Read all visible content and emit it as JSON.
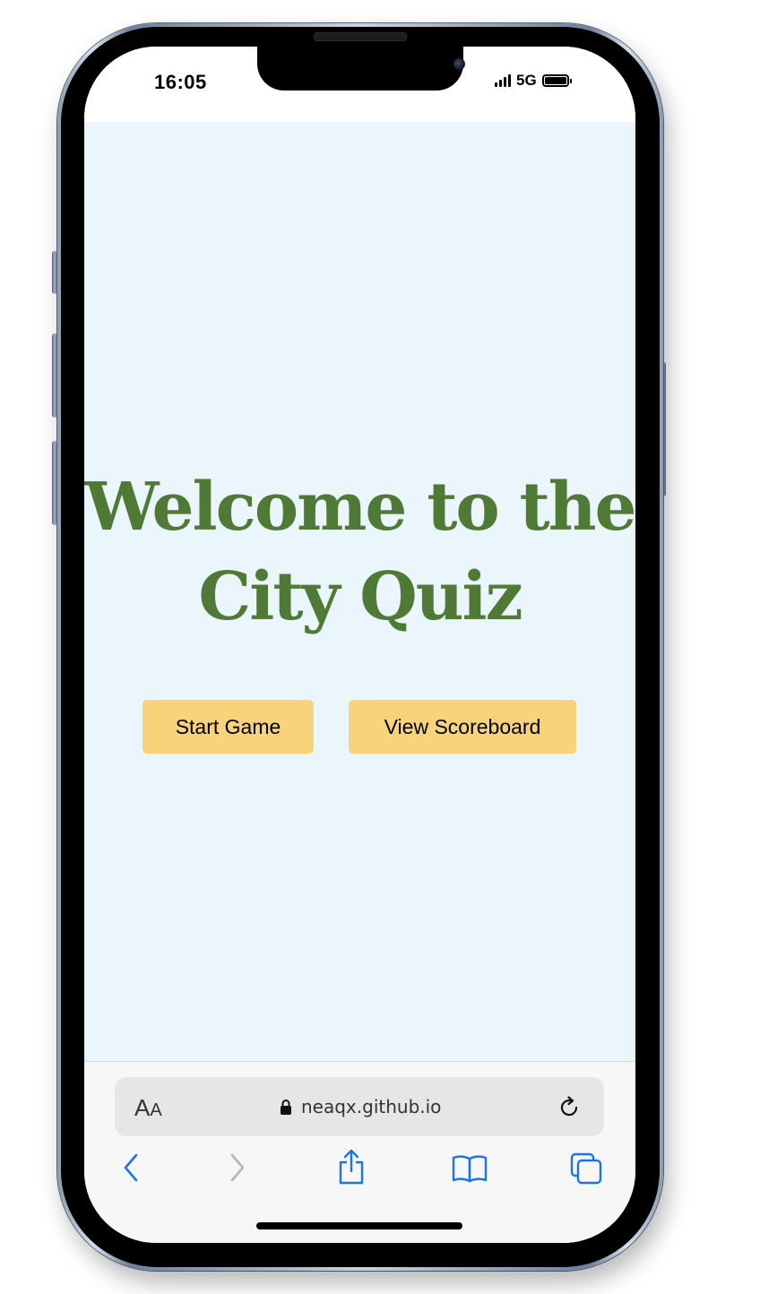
{
  "status_bar": {
    "time": "16:05",
    "network": "5G"
  },
  "page": {
    "title_line1": "Welcome to the",
    "title_line2": "City Quiz",
    "start_button_label": "Start Game",
    "scoreboard_button_label": "View Scoreboard"
  },
  "browser": {
    "text_size_label_big": "A",
    "text_size_label_small": "A",
    "url": "neaqx.github.io"
  },
  "colors": {
    "page_background": "#eaf5fc",
    "title_green": "#4f7a35",
    "button_yellow": "#f8d379",
    "toolbar_blue": "#1a73e8"
  },
  "icons": {
    "lock": "lock-icon",
    "reload": "reload-icon",
    "back": "back-chevron-icon",
    "forward": "forward-chevron-icon",
    "share": "share-icon",
    "bookmarks": "bookmarks-icon",
    "tabs": "tabs-icon"
  }
}
